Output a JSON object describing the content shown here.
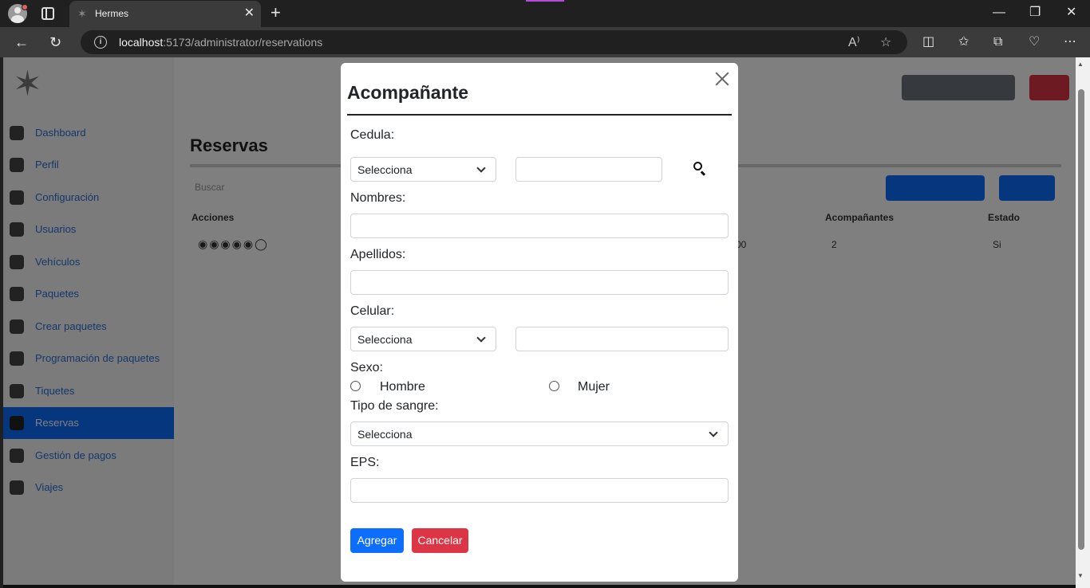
{
  "browser": {
    "tab_title": "Hermes",
    "url_host": "localhost",
    "url_rest": ":5173/administrator/reservations"
  },
  "page": {
    "title": "Reservas",
    "search_placeholder": "Buscar",
    "sidebar": [
      {
        "label": "Dashboard",
        "icon": "speedometer-icon"
      },
      {
        "label": "Perfil",
        "icon": "user-icon"
      },
      {
        "label": "Configuración",
        "icon": "gear-icon"
      },
      {
        "label": "Usuarios",
        "icon": "users-icon"
      },
      {
        "label": "Vehículos",
        "icon": "bus-icon"
      },
      {
        "label": "Paquetes",
        "icon": "package-icon"
      },
      {
        "label": "Crear paquetes",
        "icon": "plus-circle-icon"
      },
      {
        "label": "Programación de paquetes",
        "icon": "calendar-icon"
      },
      {
        "label": "Tiquetes",
        "icon": "ticket-icon"
      },
      {
        "label": "Reservas",
        "icon": "bookmark-icon",
        "active": true
      },
      {
        "label": "Gestión de pagos",
        "icon": "money-icon"
      },
      {
        "label": "Viajes",
        "icon": "map-icon"
      }
    ],
    "table_headers": {
      "acciones": "Acciones",
      "acompanantes": "Acompañantes",
      "estado": "Estado"
    },
    "row": {
      "acompanantes": "2",
      "estado": "Si",
      "mid": "00"
    }
  },
  "modal": {
    "title": "Acompañante",
    "cedula_label": "Cedula:",
    "cedula_type_value": "Selecciona",
    "cedula_value": "",
    "nombres_label": "Nombres:",
    "nombres_value": "",
    "apellidos_label": "Apellidos:",
    "apellidos_value": "",
    "celular_label": "Celular:",
    "celular_code_value": "Selecciona",
    "celular_value": "",
    "sexo_label": "Sexo:",
    "sexo_options": [
      "Hombre",
      "Mujer"
    ],
    "sangre_label": "Tipo de sangre:",
    "sangre_value": "Selecciona",
    "eps_label": "EPS:",
    "eps_value": "",
    "add_label": "Agregar",
    "cancel_label": "Cancelar"
  },
  "colors": {
    "primary": "#0d6efd",
    "danger": "#dc3545"
  }
}
